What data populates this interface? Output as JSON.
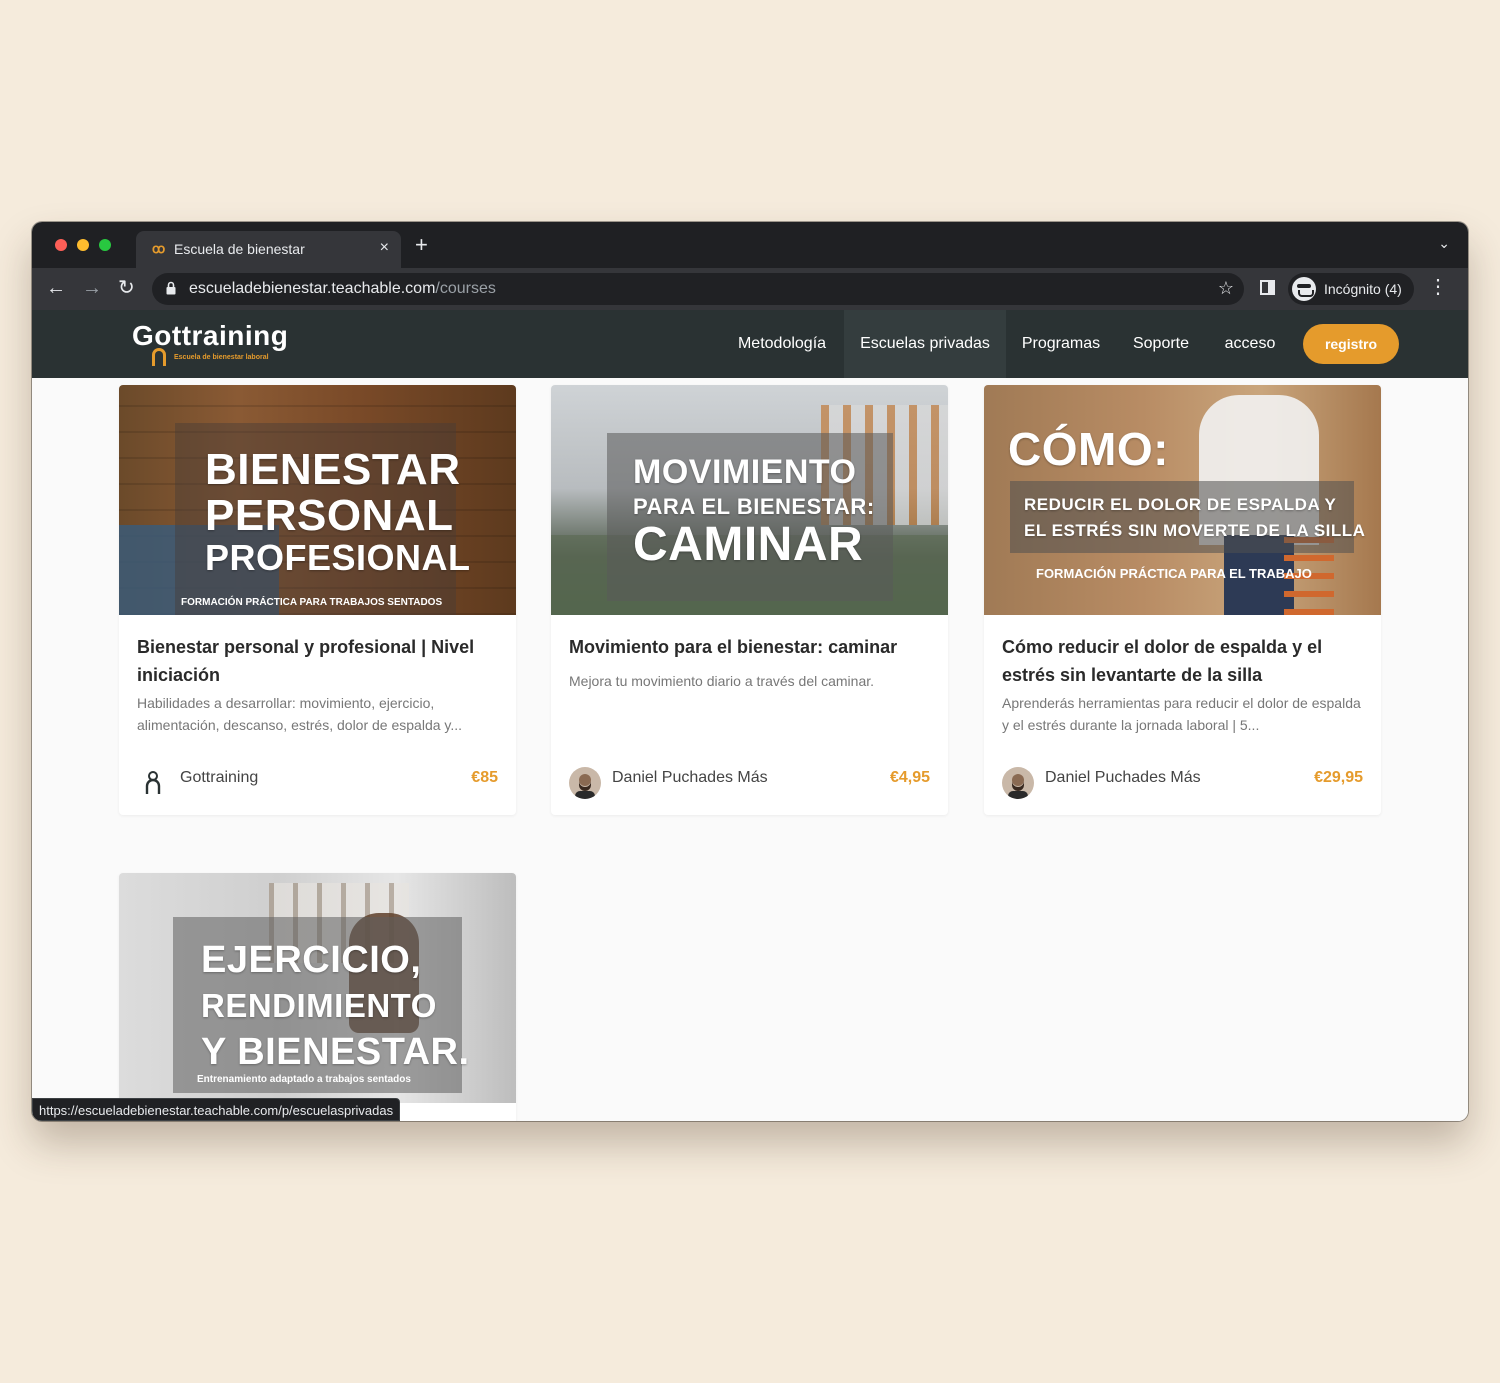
{
  "browser": {
    "tab_title": "Escuela de bienestar",
    "tab_favicon": "ꝏ",
    "close_glyph": "×",
    "newtab_glyph": "+",
    "tabmenu_glyph": "⌄",
    "back_glyph": "←",
    "forward_glyph": "→",
    "reload_glyph": "↻",
    "url_host": "escueladebienestar.teachable.com",
    "url_path": "/courses",
    "star_glyph": "☆",
    "incognito_label": "Incógnito (4)",
    "menu_glyph": "⋮",
    "status_url": "https://escueladebienestar.teachable.com/p/escuelasprivadas"
  },
  "header": {
    "logo_text": "Gottraining",
    "logo_sub": "Escuela de bienestar laboral",
    "nav": [
      "Metodología",
      "Escuelas privadas",
      "Programas",
      "Soporte",
      "acceso"
    ],
    "active_nav": "Escuelas privadas",
    "register": "registro"
  },
  "colors": {
    "accent": "#e59b2c",
    "header_bg": "#2a3233",
    "page_bg": "#f5ebdc"
  },
  "courses": [
    {
      "image_title": [
        "BIENESTAR",
        "PERSONAL",
        "PROFESIONAL"
      ],
      "image_sub": "FORMACIÓN PRÁCTICA PARA TRABAJOS SENTADOS",
      "title": "Bienestar personal y profesional | Nivel iniciación",
      "description": "Habilidades a desarrollar: movimiento, ejercicio, alimentación, descanso, estrés, dolor de espalda y...",
      "author": "Gottraining",
      "price": "€85"
    },
    {
      "image_title": [
        "MOVIMIENTO",
        "PARA EL BIENESTAR:",
        "CAMINAR"
      ],
      "title": "Movimiento para el bienestar: caminar",
      "description": "Mejora tu movimiento diario a través del caminar.",
      "author": "Daniel Puchades Más",
      "price": "€4,95"
    },
    {
      "image_title": [
        "CÓMO:",
        "REDUCIR EL DOLOR DE ESPALDA Y",
        "EL ESTRÉS SIN MOVERTE DE LA SILLA"
      ],
      "image_sub": "FORMACIÓN PRÁCTICA PARA EL TRABAJO",
      "title": "Cómo reducir el dolor de espalda y el estrés sin levantarte de la silla",
      "description": "Aprenderás herramientas para reducir el dolor de espalda y el estrés durante la jornada laboral | 5...",
      "author": "Daniel Puchades Más",
      "price": "€29,95"
    },
    {
      "image_title": [
        "EJERCICIO,",
        "RENDIMIENTO",
        "Y BIENESTAR."
      ],
      "image_sub": "Entrenamiento adaptado a trabajos sentados"
    }
  ]
}
